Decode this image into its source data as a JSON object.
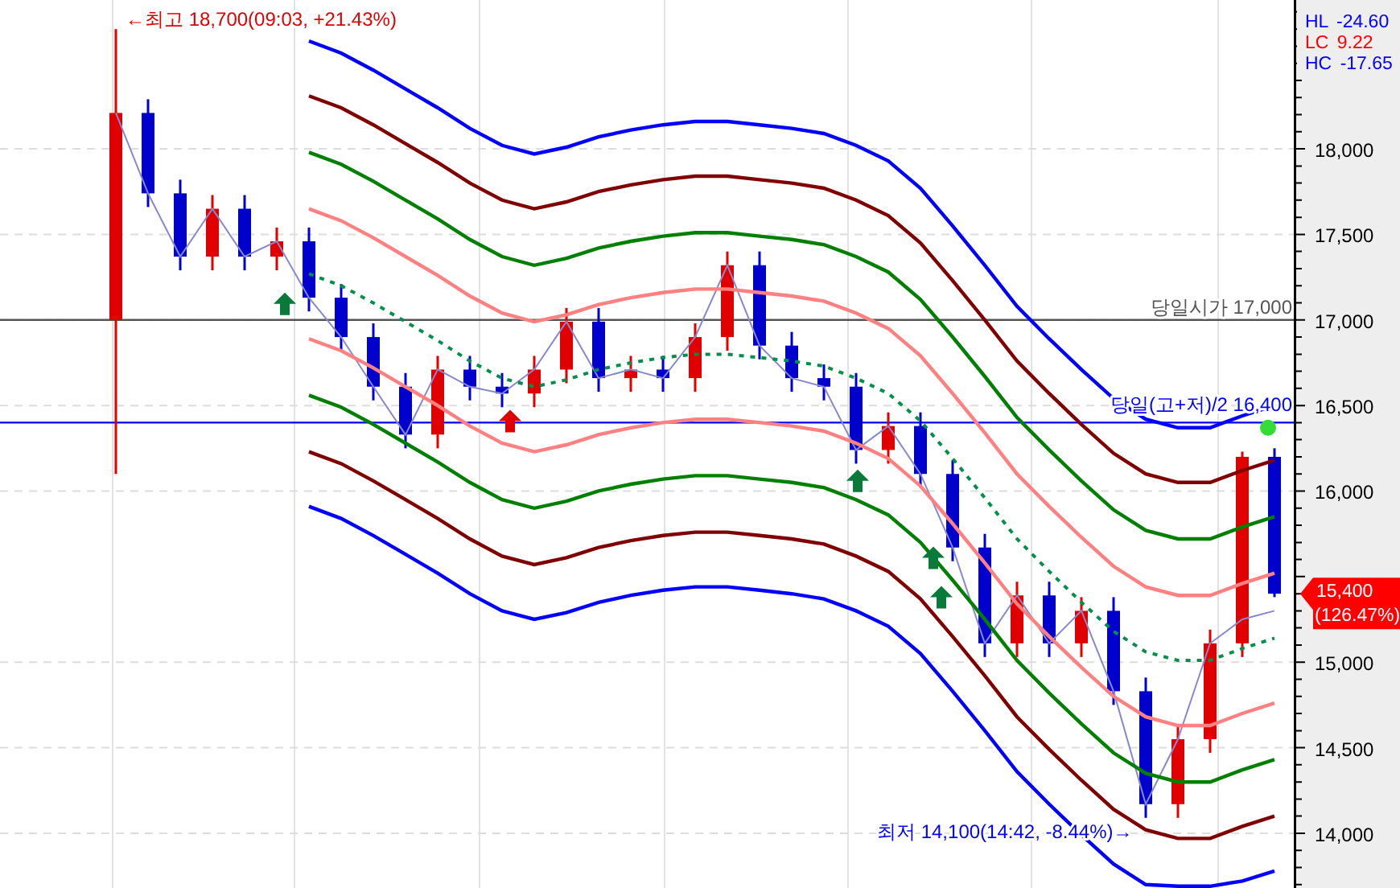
{
  "chart": {
    "chart_data": {
      "type": "candlestick",
      "ylim": [
        13680,
        18870
      ],
      "grid": true,
      "categories": [
        null,
        null,
        null,
        null,
        null,
        null,
        null,
        null,
        null,
        null,
        null,
        null,
        null,
        null,
        null,
        null,
        null,
        null,
        null,
        null,
        null,
        null,
        null,
        null,
        null,
        null,
        null,
        null,
        null,
        null,
        null,
        null,
        null,
        null,
        null,
        null,
        null
      ],
      "ohlc": [
        [
          17000,
          18700,
          16100,
          18210
        ],
        [
          18210,
          18290,
          17660,
          17740
        ],
        [
          17740,
          17820,
          17290,
          17370
        ],
        [
          17370,
          17730,
          17290,
          17650
        ],
        [
          17650,
          17730,
          17290,
          17370
        ],
        [
          17370,
          17540,
          17290,
          17460
        ],
        [
          17460,
          17540,
          17050,
          17130
        ],
        [
          17130,
          17210,
          16820,
          16900
        ],
        [
          16900,
          16980,
          16530,
          16610
        ],
        [
          16610,
          16690,
          16250,
          16330
        ],
        [
          16330,
          16790,
          16250,
          16710
        ],
        [
          16710,
          16790,
          16530,
          16610
        ],
        [
          16610,
          16690,
          16490,
          16570
        ],
        [
          16570,
          16790,
          16490,
          16710
        ],
        [
          16710,
          17070,
          16630,
          16990
        ],
        [
          16990,
          17070,
          16580,
          16660
        ],
        [
          16660,
          16790,
          16580,
          16710
        ],
        [
          16710,
          16790,
          16580,
          16660
        ],
        [
          16660,
          16980,
          16580,
          16900
        ],
        [
          16900,
          17400,
          16820,
          17320
        ],
        [
          17320,
          17400,
          16770,
          16850
        ],
        [
          16850,
          16930,
          16580,
          16660
        ],
        [
          16660,
          16740,
          16530,
          16610
        ],
        [
          16610,
          16690,
          16160,
          16240
        ],
        [
          16240,
          16460,
          16160,
          16380
        ],
        [
          16380,
          16460,
          16020,
          16100
        ],
        [
          16100,
          16180,
          15590,
          15670
        ],
        [
          15670,
          15750,
          15030,
          15110
        ],
        [
          15110,
          15470,
          15030,
          15390
        ],
        [
          15390,
          15470,
          15030,
          15110
        ],
        [
          15110,
          15380,
          15030,
          15300
        ],
        [
          15300,
          15380,
          14750,
          14830
        ],
        [
          14830,
          14910,
          14090,
          14170
        ],
        [
          14170,
          14630,
          14090,
          14550
        ],
        [
          14550,
          15190,
          14470,
          15110
        ],
        [
          15110,
          16230,
          15030,
          16200
        ],
        [
          16200,
          16250,
          15380,
          15400
        ]
      ],
      "ref_lines": [
        {
          "axis": "y",
          "value": 17000,
          "label": "당일시가 17,000",
          "color": "#555555"
        },
        {
          "axis": "y",
          "value": 16400,
          "label": "당일(고+저)/2 16,400",
          "color": "#0000ff"
        }
      ],
      "yticks": [
        {
          "value": 14000,
          "label": "14,000"
        },
        {
          "value": 14500,
          "label": "14,500"
        },
        {
          "value": 15000,
          "label": "15,000"
        },
        {
          "value": 16000,
          "label": "16,000"
        },
        {
          "value": 16500,
          "label": "16,500"
        },
        {
          "value": 17000,
          "label": "17,000"
        },
        {
          "value": 17500,
          "label": "17,500"
        },
        {
          "value": 18000,
          "label": "18,000"
        }
      ]
    },
    "high_label": "←최고 18,700(09:03, +21.43%)",
    "low_label": "최저 14,100(14:42, -8.44%)→",
    "signals": [
      {
        "kind": "arrow",
        "color": "#0a7a3a"
      },
      {
        "kind": "arrow",
        "color": "#e00000"
      },
      {
        "kind": "arrow",
        "color": "#0a7a3a"
      },
      {
        "kind": "arrow",
        "color": "#0a7a3a"
      },
      {
        "kind": "arrow",
        "color": "#0a7a3a"
      },
      {
        "kind": "circle",
        "color": "#33dd33"
      }
    ],
    "price_tag": {
      "label": "15,400",
      "sublabel": "(126.47%)"
    }
  },
  "overlay": {
    "chart_data": {
      "type": "line",
      "ylim": [
        13680,
        18870
      ],
      "categories": [
        null,
        null,
        null,
        null,
        null,
        null,
        null,
        null,
        null,
        null,
        null,
        null,
        null,
        null,
        null,
        null,
        null,
        null,
        null,
        null,
        null,
        null,
        null,
        null,
        null,
        null,
        null,
        null,
        null,
        null,
        null,
        null,
        null,
        null,
        null,
        null,
        null
      ],
      "series": [
        {
          "color": "#8888cc",
          "values": [
            18210,
            17740,
            17370,
            17650,
            17370,
            17460,
            17130,
            16900,
            16610,
            16330,
            16710,
            16610,
            16570,
            16710,
            16990,
            16660,
            16710,
            16660,
            16900,
            17320,
            16850,
            16660,
            16610,
            16240,
            16380,
            16100,
            15670,
            15110,
            15390,
            15110,
            15300,
            14830,
            14170,
            14550,
            15110,
            15250,
            15300
          ]
        },
        {
          "color": "#0000ff",
          "values": [
            null,
            null,
            null,
            null,
            null,
            null,
            18630,
            18560,
            18460,
            18350,
            18240,
            18120,
            18020,
            17970,
            18010,
            18070,
            18110,
            18140,
            18160,
            18160,
            18140,
            18120,
            18090,
            18020,
            17930,
            17770,
            17550,
            17320,
            17080,
            16890,
            16710,
            16540,
            16420,
            16370,
            16370,
            16440,
            16500
          ]
        },
        {
          "color": "#800000",
          "values": [
            null,
            null,
            null,
            null,
            null,
            null,
            18310,
            18240,
            18140,
            18030,
            17920,
            17800,
            17700,
            17650,
            17690,
            17750,
            17790,
            17820,
            17840,
            17840,
            17820,
            17800,
            17770,
            17700,
            17610,
            17450,
            17230,
            17000,
            16760,
            16570,
            16390,
            16220,
            16100,
            16050,
            16050,
            16120,
            16180
          ]
        },
        {
          "color": "#008000",
          "values": [
            null,
            null,
            null,
            null,
            null,
            null,
            17980,
            17910,
            17810,
            17700,
            17590,
            17470,
            17370,
            17320,
            17360,
            17420,
            17460,
            17490,
            17510,
            17510,
            17490,
            17470,
            17440,
            17370,
            17280,
            17120,
            16900,
            16670,
            16430,
            16240,
            16060,
            15890,
            15770,
            15720,
            15720,
            15790,
            15850
          ]
        },
        {
          "color": "#ff8080",
          "values": [
            null,
            null,
            null,
            null,
            null,
            null,
            17650,
            17580,
            17480,
            17370,
            17260,
            17140,
            17040,
            16990,
            17030,
            17090,
            17130,
            17160,
            17180,
            17180,
            17160,
            17140,
            17110,
            17040,
            16950,
            16790,
            16570,
            16340,
            16100,
            15910,
            15730,
            15560,
            15440,
            15390,
            15390,
            15460,
            15520
          ]
        },
        {
          "color": "#00904a",
          "line_style": "dotted",
          "values": [
            null,
            null,
            null,
            null,
            null,
            null,
            17270,
            17200,
            17100,
            16990,
            16880,
            16760,
            16660,
            16610,
            16650,
            16710,
            16750,
            16780,
            16800,
            16800,
            16780,
            16760,
            16730,
            16660,
            16570,
            16410,
            16190,
            15960,
            15720,
            15530,
            15350,
            15180,
            15060,
            15010,
            15010,
            15080,
            15140
          ]
        },
        {
          "color": "#ff8080",
          "values": [
            null,
            null,
            null,
            null,
            null,
            null,
            16890,
            16820,
            16720,
            16610,
            16500,
            16380,
            16280,
            16230,
            16270,
            16330,
            16370,
            16400,
            16420,
            16420,
            16400,
            16380,
            16350,
            16280,
            16190,
            16030,
            15810,
            15580,
            15340,
            15150,
            14970,
            14800,
            14680,
            14630,
            14630,
            14700,
            14760
          ]
        },
        {
          "color": "#008000",
          "values": [
            null,
            null,
            null,
            null,
            null,
            null,
            16560,
            16490,
            16390,
            16280,
            16170,
            16050,
            15950,
            15900,
            15940,
            16000,
            16040,
            16070,
            16090,
            16090,
            16070,
            16050,
            16020,
            15950,
            15860,
            15700,
            15480,
            15250,
            15010,
            14820,
            14640,
            14470,
            14350,
            14300,
            14300,
            14370,
            14430
          ]
        },
        {
          "color": "#800000",
          "values": [
            null,
            null,
            null,
            null,
            null,
            null,
            16230,
            16160,
            16060,
            15950,
            15840,
            15720,
            15620,
            15570,
            15610,
            15670,
            15710,
            15740,
            15760,
            15760,
            15740,
            15720,
            15690,
            15620,
            15530,
            15370,
            15150,
            14920,
            14680,
            14490,
            14310,
            14140,
            14020,
            13970,
            13970,
            14040,
            14100
          ]
        },
        {
          "color": "#0000ff",
          "values": [
            null,
            null,
            null,
            null,
            null,
            null,
            15910,
            15840,
            15740,
            15630,
            15520,
            15400,
            15300,
            15250,
            15290,
            15350,
            15390,
            15420,
            15440,
            15440,
            15420,
            15400,
            15370,
            15300,
            15210,
            15050,
            14830,
            14600,
            14360,
            14170,
            13990,
            13820,
            13700,
            13690,
            13690,
            13720,
            13780
          ]
        }
      ]
    }
  },
  "legend": [
    {
      "code": "HL",
      "value": "-24.60",
      "color": "#0000ff"
    },
    {
      "code": "LC",
      "value": "9.22",
      "color": "#ff0000"
    },
    {
      "code": "HC",
      "value": "-17.65",
      "color": "#0000ff"
    }
  ]
}
